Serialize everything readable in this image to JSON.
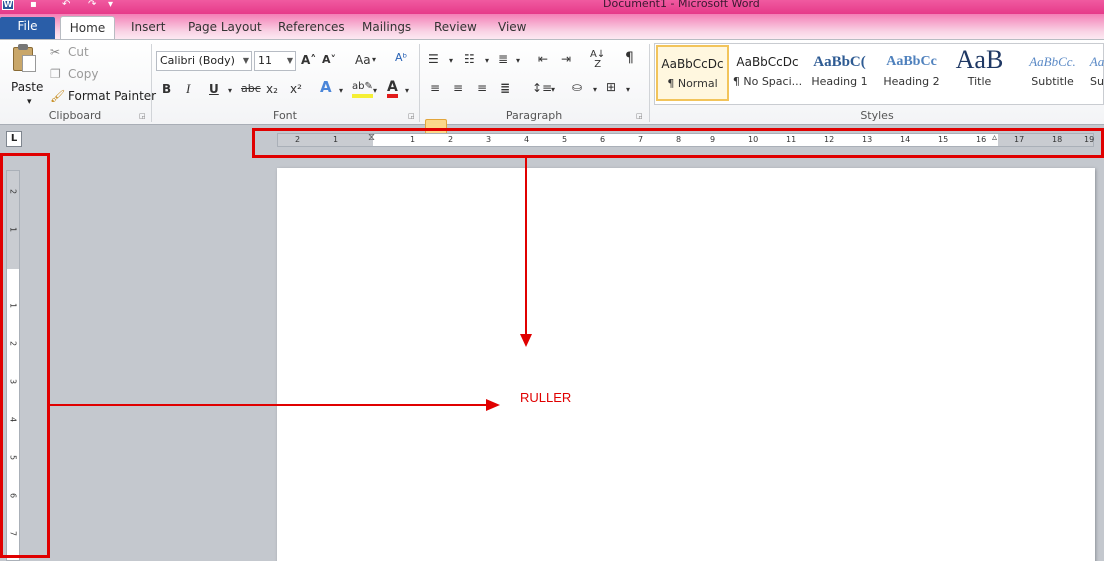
{
  "window": {
    "title": "Document1 - Microsoft Word",
    "app_icon": "W"
  },
  "tabs": [
    "File",
    "Home",
    "Insert",
    "Page Layout",
    "References",
    "Mailings",
    "Review",
    "View"
  ],
  "clipboard": {
    "paste": "Paste",
    "cut": "Cut",
    "copy": "Copy",
    "format_painter": "Format Painter",
    "label": "Clipboard"
  },
  "font": {
    "name": "Calibri (Body)",
    "size": "11",
    "label": "Font",
    "bold": "B",
    "italic": "I",
    "underline": "U",
    "strike": "abc",
    "sub": "x₂",
    "sup": "x²",
    "grow": "A˄",
    "shrink": "A˅",
    "case": "Aa"
  },
  "paragraph": {
    "label": "Paragraph",
    "show_marks": "¶"
  },
  "styles": {
    "label": "Styles",
    "items": [
      {
        "preview": "AaBbCcDc",
        "name": "¶ Normal"
      },
      {
        "preview": "AaBbCcDc",
        "name": "¶ No Spaci..."
      },
      {
        "preview": "AaBbC(",
        "name": "Heading 1"
      },
      {
        "preview": "AaBbCc",
        "name": "Heading 2"
      },
      {
        "preview": "AaB",
        "name": "Title"
      },
      {
        "preview": "AaBbCc.",
        "name": "Subtitle"
      },
      {
        "preview": "Aa",
        "name": "Su"
      }
    ]
  },
  "ruler": {
    "corner": "L",
    "h_ticks": [
      "2",
      "1",
      "1",
      "2",
      "3",
      "4",
      "5",
      "6",
      "7",
      "8",
      "9",
      "10",
      "11",
      "12",
      "13",
      "14",
      "15",
      "16",
      "17",
      "18",
      "19"
    ],
    "v_ticks": [
      "2",
      "1",
      "1",
      "2",
      "3",
      "4",
      "5",
      "6",
      "7"
    ]
  },
  "annotation": {
    "label": "RULLER",
    "color": "#e00000"
  }
}
